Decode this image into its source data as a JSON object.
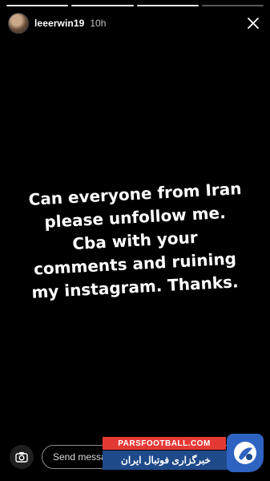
{
  "story": {
    "progress_segments": 4,
    "progress_completed": 3,
    "username": "leeerwin19",
    "time_ago": "10h",
    "lines": [
      "Can everyone from Iran",
      "please unfollow me.",
      "Cba with your",
      "comments and ruining",
      "my instagram. Thanks."
    ]
  },
  "composer": {
    "placeholder": "Send message"
  },
  "watermark": {
    "top_text": "PARSFOOTBALL.COM",
    "bottom_text": "خبرگزاری فوتبال ایران"
  },
  "icons": {
    "close": "close-icon",
    "camera": "camera-icon",
    "logo": "parsfootball-logo-icon"
  },
  "colors": {
    "background": "#000000",
    "text": "#ffffff",
    "watermark_red": "#e53936",
    "watermark_blue": "#1f4a8a"
  }
}
